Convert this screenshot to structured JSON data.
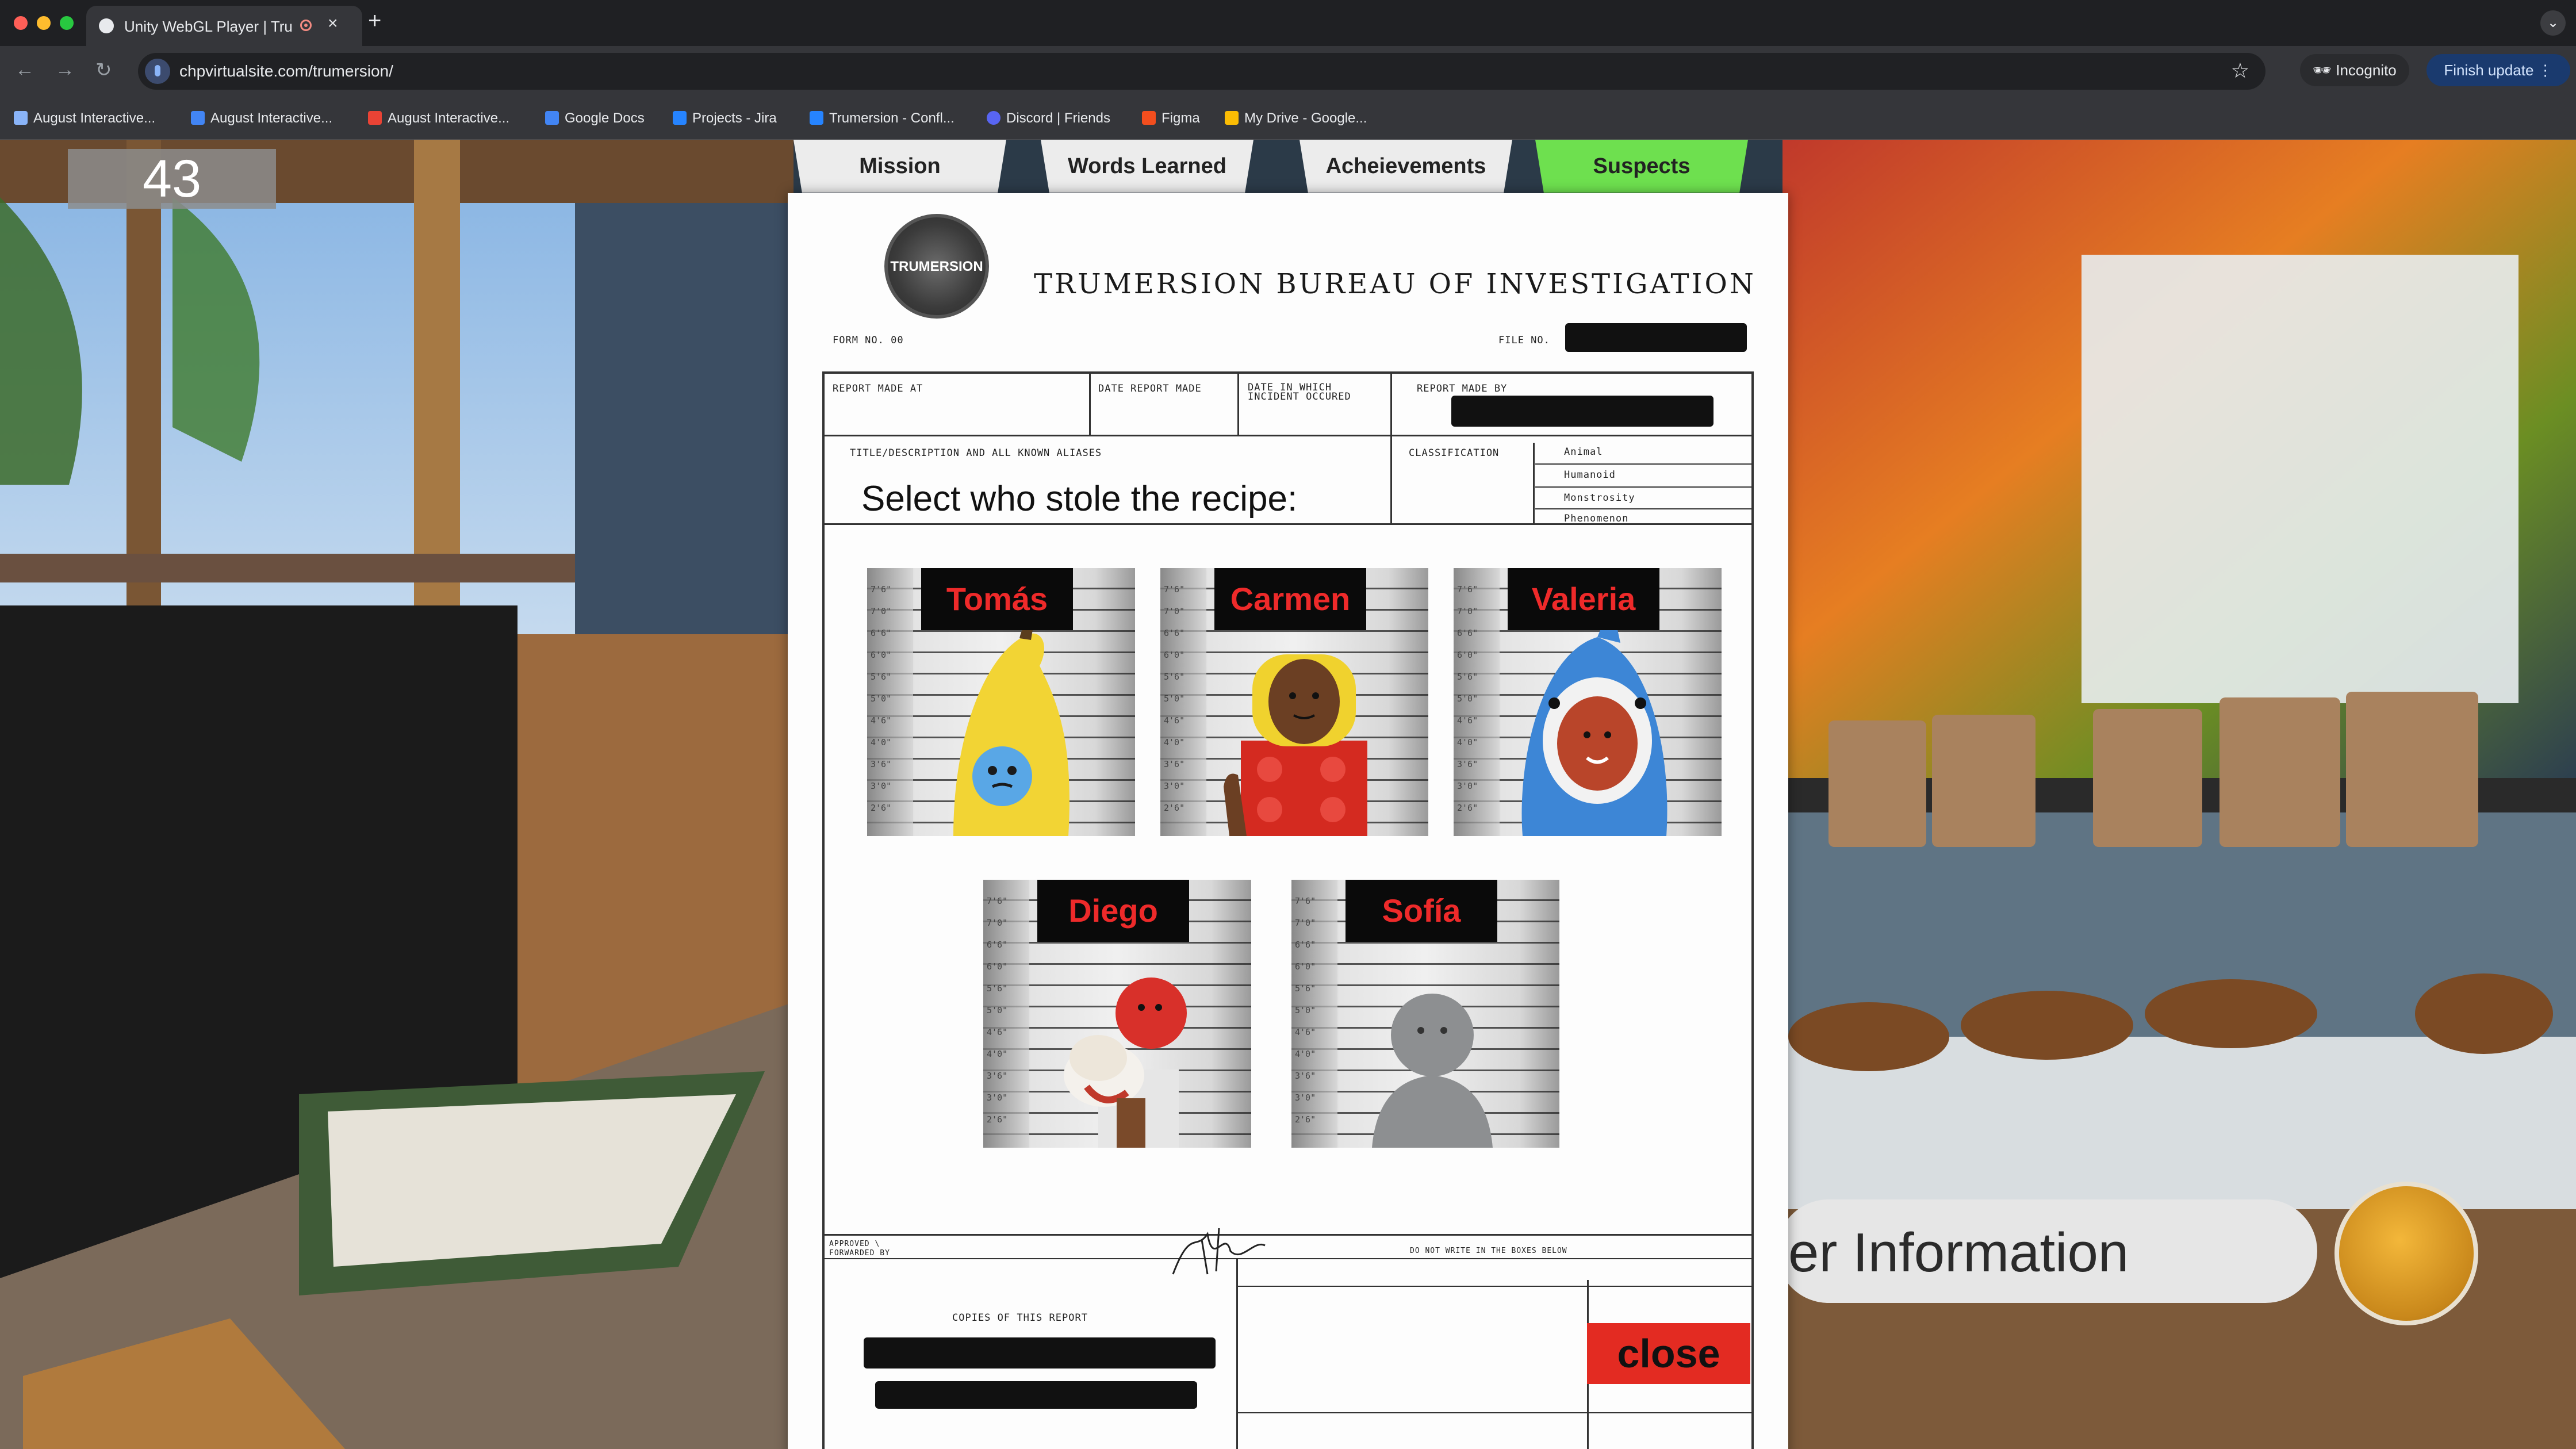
{
  "browser": {
    "tab_title": "Unity WebGL Player | Tru",
    "tab_close": "×",
    "new_tab": "+",
    "url": "chpvirtualsite.com/trumersion/",
    "incognito_label": "Incognito",
    "finish_update_label": "Finish update",
    "bookmarks": [
      {
        "label": "August Interactive...",
        "icon_color": "#8ab4f8"
      },
      {
        "label": "August Interactive...",
        "icon_color": "#4285f4"
      },
      {
        "label": "August Interactive...",
        "icon_color": "#ea4335"
      },
      {
        "label": "Google Docs",
        "icon_color": "#4285f4"
      },
      {
        "label": "Projects - Jira",
        "icon_color": "#2684ff"
      },
      {
        "label": "Trumersion - Confl...",
        "icon_color": "#2684ff"
      },
      {
        "label": "Discord | Friends",
        "icon_color": "#5865f2"
      },
      {
        "label": "Figma",
        "icon_color": "#f24e1e"
      },
      {
        "label": "My Drive - Google...",
        "icon_color": "#fbbc04"
      }
    ]
  },
  "game": {
    "timer": "43",
    "info_button_text": "er Information",
    "tabs": [
      {
        "label": "Mission",
        "active": false
      },
      {
        "label": "Words Learned",
        "active": false
      },
      {
        "label": "Acheievements",
        "active": false
      },
      {
        "label": "Suspects",
        "active": true
      }
    ],
    "document": {
      "seal_text": "TRUMERSION",
      "bureau_title": "TRUMERSION BUREAU OF INVESTIGATION",
      "form_no": "FORM NO. 00",
      "file_no": "FILE NO.",
      "report_made_at": "REPORT MADE AT",
      "date_report_made": "DATE REPORT MADE",
      "date_incident": "DATE IN WHICH INCIDENT OCCURED",
      "report_made_by": "REPORT MADE BY",
      "title_description": "TITLE/DESCRIPTION AND ALL KNOWN ALIASES",
      "classification_label": "CLASSIFICATION",
      "classifications": [
        "Animal",
        "Humanoid",
        "Monstrosity",
        "Phenomenon"
      ],
      "prompt": "Select who stole the recipe:",
      "approved": "APPROVED \\ FORWARDED BY",
      "do_not_write": "DO NOT WRITE IN THE BOXES BELOW",
      "copies": "COPIES OF THIS REPORT",
      "close_label": "close"
    },
    "suspects": [
      {
        "name": "Tomás",
        "costume": "banana"
      },
      {
        "name": "Carmen",
        "costume": "lego"
      },
      {
        "name": "Valeria",
        "costume": "shark"
      },
      {
        "name": "Diego",
        "costume": "balloon"
      },
      {
        "name": "Sofía",
        "costume": "mannequin"
      }
    ],
    "ruler_marks": [
      "7'6\"",
      "7'0\"",
      "6'6\"",
      "6'0\"",
      "5'6\"",
      "5'0\"",
      "4'6\"",
      "4'0\"",
      "3'6\"",
      "3'0\"",
      "2'6\""
    ]
  }
}
